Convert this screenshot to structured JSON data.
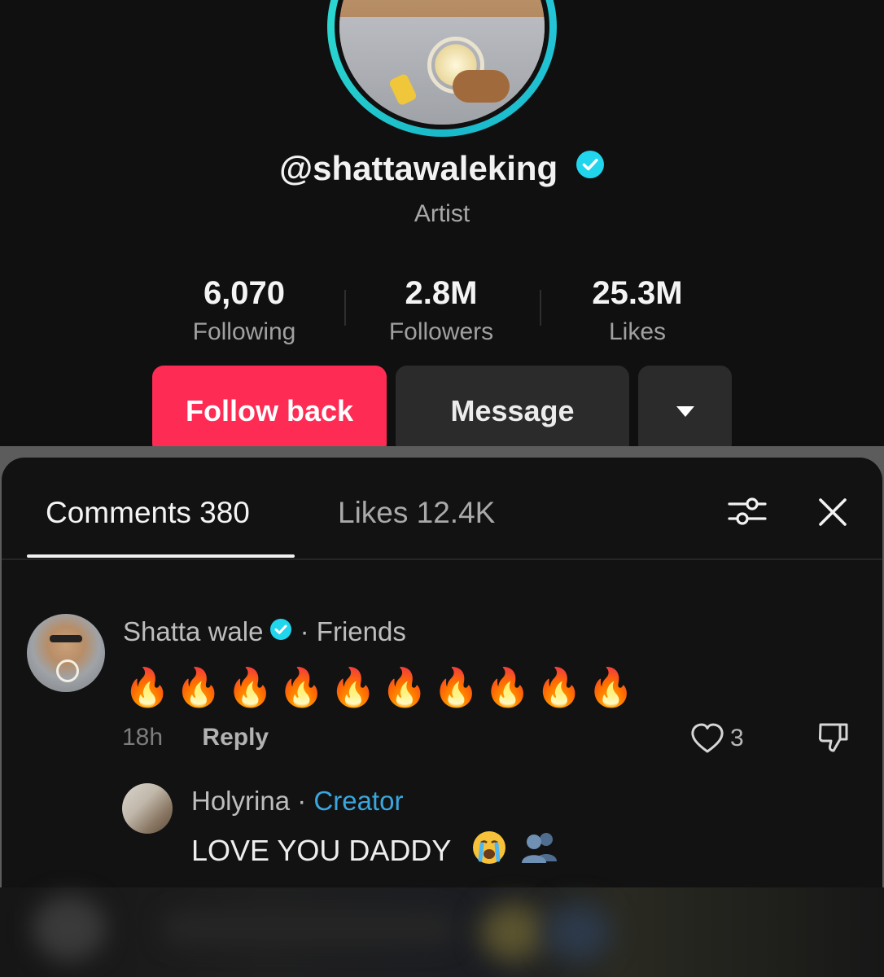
{
  "profile": {
    "handle": "@shattawaleking",
    "bio": "Artist",
    "stats": [
      {
        "value": "6,070",
        "label": "Following"
      },
      {
        "value": "2.8M",
        "label": "Followers"
      },
      {
        "value": "25.3M",
        "label": "Likes"
      }
    ],
    "follow_label": "Follow back",
    "message_label": "Message",
    "more_icon": "caret-down-icon"
  },
  "sheet": {
    "tabs": [
      {
        "label": "Comments 380"
      },
      {
        "label": "Likes 12.4K"
      }
    ],
    "filter_icon": "sliders-icon",
    "close_icon": "close-icon"
  },
  "comments": [
    {
      "name": "Shatta wale",
      "separator": "·",
      "relation": "Friends",
      "text": "🔥🔥🔥🔥🔥🔥🔥🔥🔥🔥",
      "time": "18h",
      "reply_label": "Reply",
      "likes": "3"
    },
    {
      "name": "Holyrina",
      "separator": "·",
      "relation": "Creator",
      "text": "LOVE YOU DADDY"
    }
  ],
  "colors": {
    "accent": "#fe2c55",
    "verified": "#20d5ec",
    "creator": "#3aa6dd",
    "ring": "#2ed3d8"
  }
}
